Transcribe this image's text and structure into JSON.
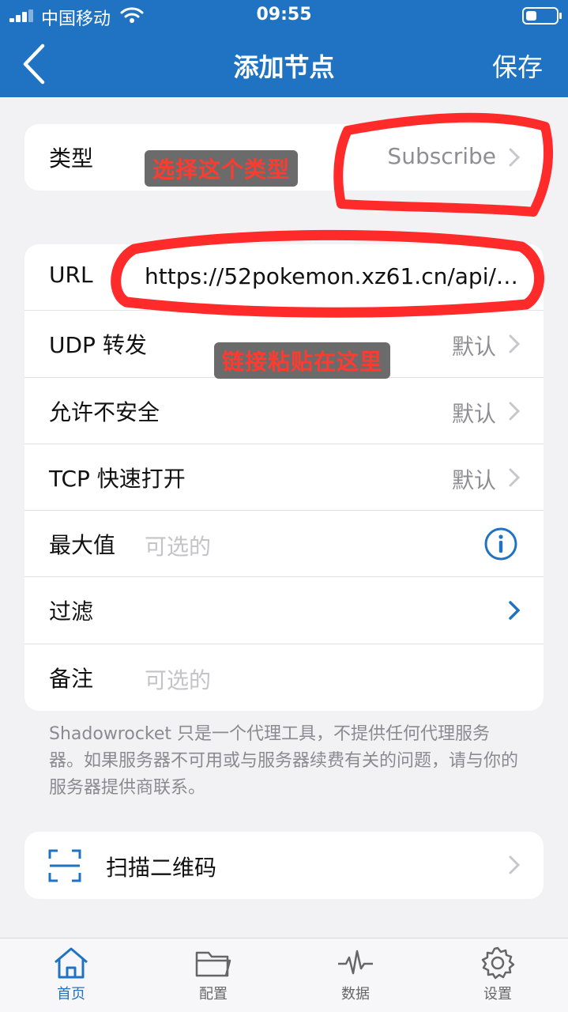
{
  "status_bar": {
    "carrier": "中国移动",
    "time": "09:55",
    "battery_level": 0.35
  },
  "nav": {
    "title": "添加节点",
    "save_label": "保存",
    "back_icon": "chevron-left-icon"
  },
  "type_row": {
    "label": "类型",
    "value": "Subscribe"
  },
  "form_rows": {
    "url": {
      "label": "URL",
      "value": "https://52pokemon.xz61.cn/api/v..."
    },
    "udp": {
      "label": "UDP 转发",
      "value": "默认"
    },
    "insecure": {
      "label": "允许不安全",
      "value": "默认"
    },
    "tcp_fast_open": {
      "label": "TCP 快速打开",
      "value": "默认"
    },
    "max_value": {
      "label": "最大值",
      "placeholder": "可选的",
      "icon": "info-icon"
    },
    "filter": {
      "label": "过滤"
    },
    "remark": {
      "label": "备注",
      "placeholder": "可选的"
    }
  },
  "footnote": "Shadowrocket 只是一个代理工具，不提供任何代理服务器。如果服务器不可用或与服务器续费有关的问题，请与你的服务器提供商联系。",
  "scan": {
    "label": "扫描二维码",
    "icon": "qr-scan-icon"
  },
  "annotations": {
    "type_hint": "选择这个类型",
    "url_hint": "链接粘贴在这里"
  },
  "tabbar": [
    {
      "label": "首页",
      "icon": "home-icon",
      "active": true
    },
    {
      "label": "配置",
      "icon": "folder-icon",
      "active": false
    },
    {
      "label": "数据",
      "icon": "activity-icon",
      "active": false
    },
    {
      "label": "设置",
      "icon": "gear-icon",
      "active": false
    }
  ],
  "colors": {
    "brand_blue": "#1f73c2",
    "background": "#f2f2f4",
    "annotation_red": "#ff3b30",
    "annotation_bg": "#6b6b6b"
  }
}
